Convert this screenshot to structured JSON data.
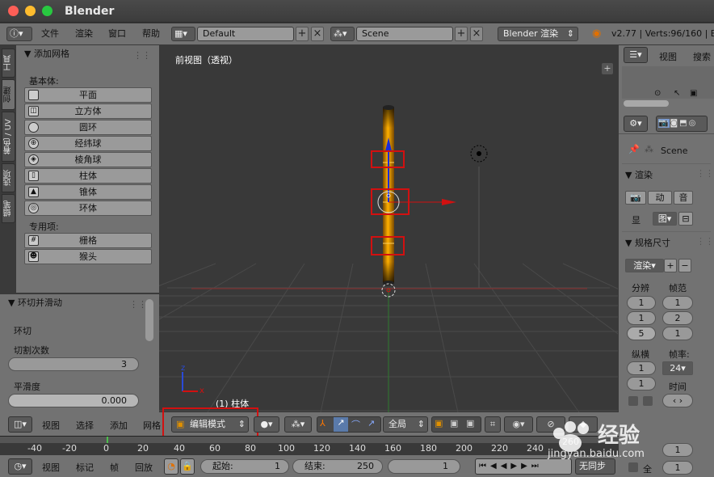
{
  "app": {
    "title": "Blender"
  },
  "infobar": {
    "menus": [
      "文件",
      "渲染",
      "窗口",
      "帮助"
    ],
    "layout": "Default",
    "scene": "Scene",
    "engine": "Blender 渲染",
    "version": "v2.77 | Verts:96/160 | Ed"
  },
  "tool_tabs": [
    "工具",
    "创建",
    "着色 / UV",
    "选项",
    "蜡笔"
  ],
  "toolpanel": {
    "header": "▼ 添加网格",
    "group1": "基本体:",
    "buttons": [
      "平面",
      "立方体",
      "圆环",
      "经纬球",
      "棱角球",
      "柱体",
      "锥体",
      "环体"
    ],
    "group2": "专用项:",
    "special": [
      "栅格",
      "猴头"
    ]
  },
  "op_panel": {
    "header": "▼ 环切并滑动",
    "subheader": "环切",
    "cuts_label": "切割次数",
    "cuts_value": "3",
    "smooth_label": "平滑度",
    "smooth_value": "0.000"
  },
  "viewport": {
    "label": "前视图（透视）",
    "object_label": "(1) 柱体",
    "axis_x": "x",
    "axis_z": "z"
  },
  "vpheader": {
    "menus": [
      "视图",
      "选择",
      "添加",
      "网格"
    ],
    "mode": "编辑模式",
    "pivot": "全局"
  },
  "timeline": {
    "ticks": [
      "-40",
      "-20",
      "0",
      "20",
      "40",
      "60",
      "80",
      "100",
      "120",
      "140",
      "160",
      "180",
      "200",
      "220",
      "240",
      "260"
    ]
  },
  "tlheader": {
    "menus": [
      "视图",
      "标记",
      "帧",
      "回放"
    ],
    "start_label": "起始:",
    "start_value": "1",
    "end_label": "结束:",
    "end_value": "250",
    "current": "1",
    "sync": "无同步"
  },
  "outliner": {
    "view": "视图",
    "search": "搜索"
  },
  "props": {
    "scene": "Scene",
    "render_header": "▼ 渲染",
    "render_btn": "渲",
    "anim_btn": "动",
    "audio_btn": "音",
    "display_label": "显",
    "display_value": "图",
    "dims_header": "▼ 规格尺寸",
    "preset": "渲染",
    "res_label": "分辨",
    "frame_label": "帧范",
    "res_x": "1",
    "res_y": "1",
    "res_pct": "5",
    "frame_start": "1",
    "frame_end": "2",
    "frame_step": "1",
    "aspect_label": "纵横",
    "fps_label": "帧率:",
    "fps": "24",
    "aspect_x": "1",
    "aspect_y": "1",
    "time_label": "时间",
    "all_label": "全",
    "extra_val": "1",
    "extra_val2": "1"
  },
  "watermark": {
    "brand": "经验",
    "site": "jingyan.baidu.com"
  },
  "colors": {
    "accent_orange": "#f0a000",
    "selection_red": "#d21010"
  }
}
